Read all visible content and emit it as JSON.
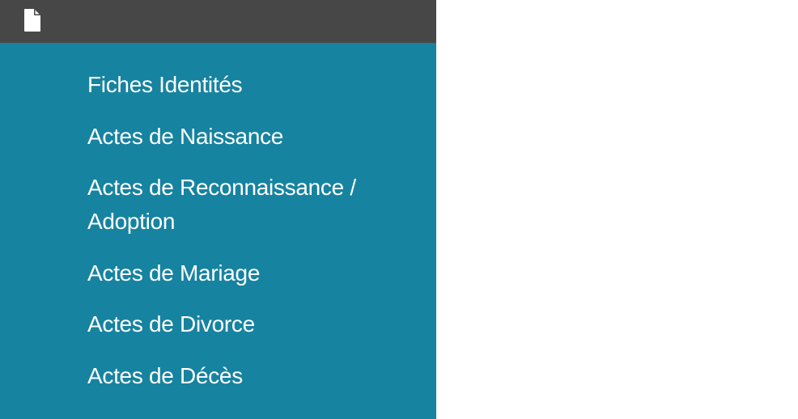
{
  "topbar": {
    "icon": "file-icon",
    "background": "#474747"
  },
  "menu": {
    "background": "#1683a0",
    "text_color": "#ffffff",
    "items": [
      {
        "label": "Fiches Identités"
      },
      {
        "label": "Actes de Naissance"
      },
      {
        "label": "Actes de Reconnaissance / Adoption"
      },
      {
        "label": "Actes de Mariage"
      },
      {
        "label": "Actes de Divorce"
      },
      {
        "label": "Actes de Décès"
      }
    ]
  }
}
